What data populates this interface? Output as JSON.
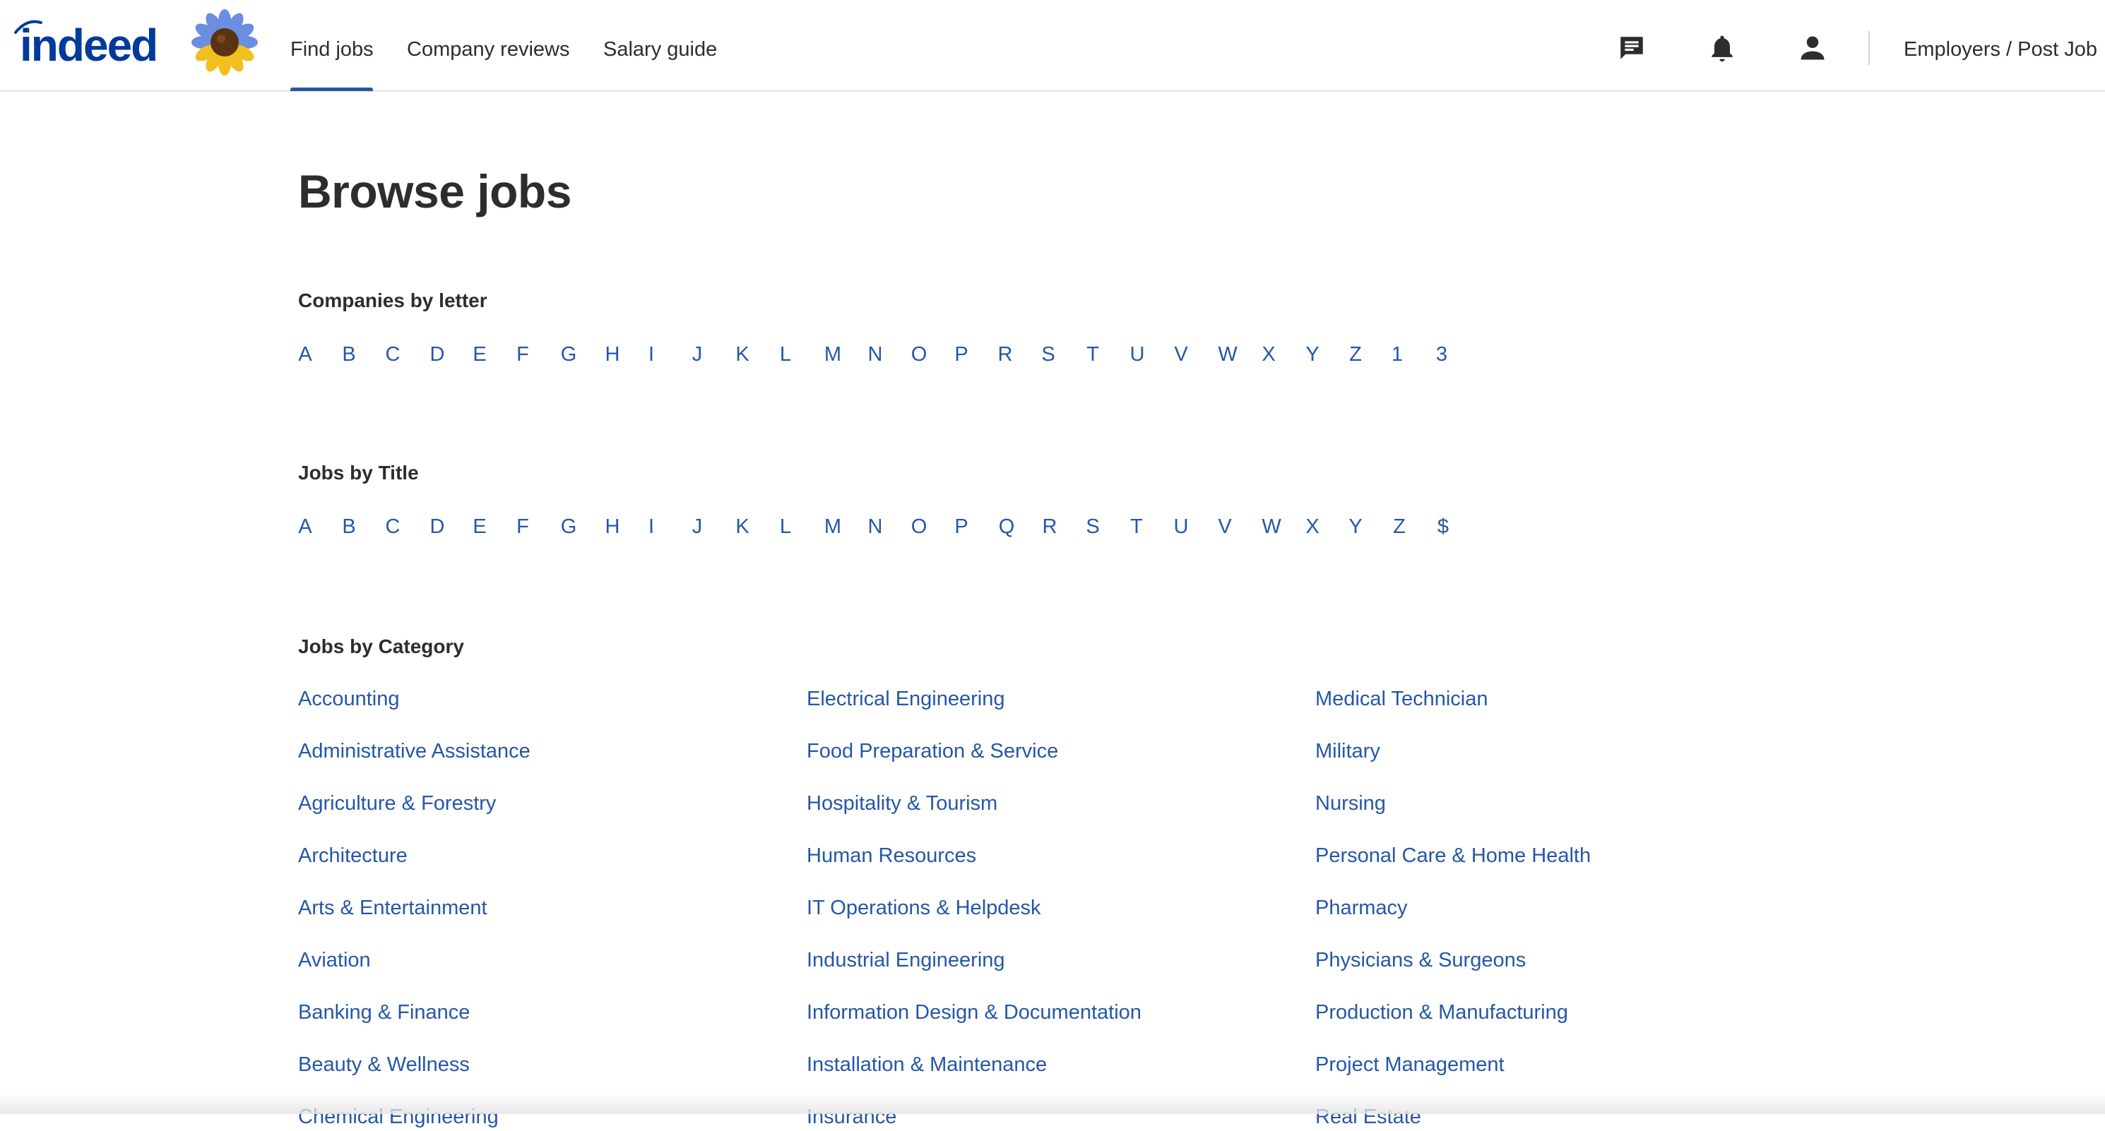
{
  "header": {
    "logo_text": "indeed",
    "nav": [
      {
        "label": "Find jobs",
        "active": true
      },
      {
        "label": "Company reviews",
        "active": false
      },
      {
        "label": "Salary guide",
        "active": false
      }
    ],
    "icons": [
      "messages-icon",
      "notifications-bell-icon",
      "profile-icon"
    ],
    "employers_link": "Employers / Post Job"
  },
  "main": {
    "title": "Browse jobs",
    "companies_by_letter": {
      "heading": "Companies by letter",
      "letters": [
        "A",
        "B",
        "C",
        "D",
        "E",
        "F",
        "G",
        "H",
        "I",
        "J",
        "K",
        "L",
        "M",
        "N",
        "O",
        "P",
        "R",
        "S",
        "T",
        "U",
        "V",
        "W",
        "X",
        "Y",
        "Z",
        "1",
        "3"
      ]
    },
    "jobs_by_title": {
      "heading": "Jobs by Title",
      "letters": [
        "A",
        "B",
        "C",
        "D",
        "E",
        "F",
        "G",
        "H",
        "I",
        "J",
        "K",
        "L",
        "M",
        "N",
        "O",
        "P",
        "Q",
        "R",
        "S",
        "T",
        "U",
        "V",
        "W",
        "X",
        "Y",
        "Z",
        "$"
      ]
    },
    "jobs_by_category": {
      "heading": "Jobs by Category",
      "columns": [
        [
          "Accounting",
          "Administrative Assistance",
          "Agriculture & Forestry",
          "Architecture",
          "Arts & Entertainment",
          "Aviation",
          "Banking & Finance",
          "Beauty & Wellness",
          "Chemical Engineering"
        ],
        [
          "Electrical Engineering",
          "Food Preparation & Service",
          "Hospitality & Tourism",
          "Human Resources",
          "IT Operations & Helpdesk",
          "Industrial Engineering",
          "Information Design & Documentation",
          "Installation & Maintenance",
          "Insurance"
        ],
        [
          "Medical Technician",
          "Military",
          "Nursing",
          "Personal Care & Home Health",
          "Pharmacy",
          "Physicians & Surgeons",
          "Production & Manufacturing",
          "Project Management",
          "Real Estate"
        ]
      ]
    }
  },
  "colors": {
    "link": "#2557a7",
    "text": "#2d2d2d",
    "logo": "#003a9b",
    "divider": "#e4e2e0"
  }
}
